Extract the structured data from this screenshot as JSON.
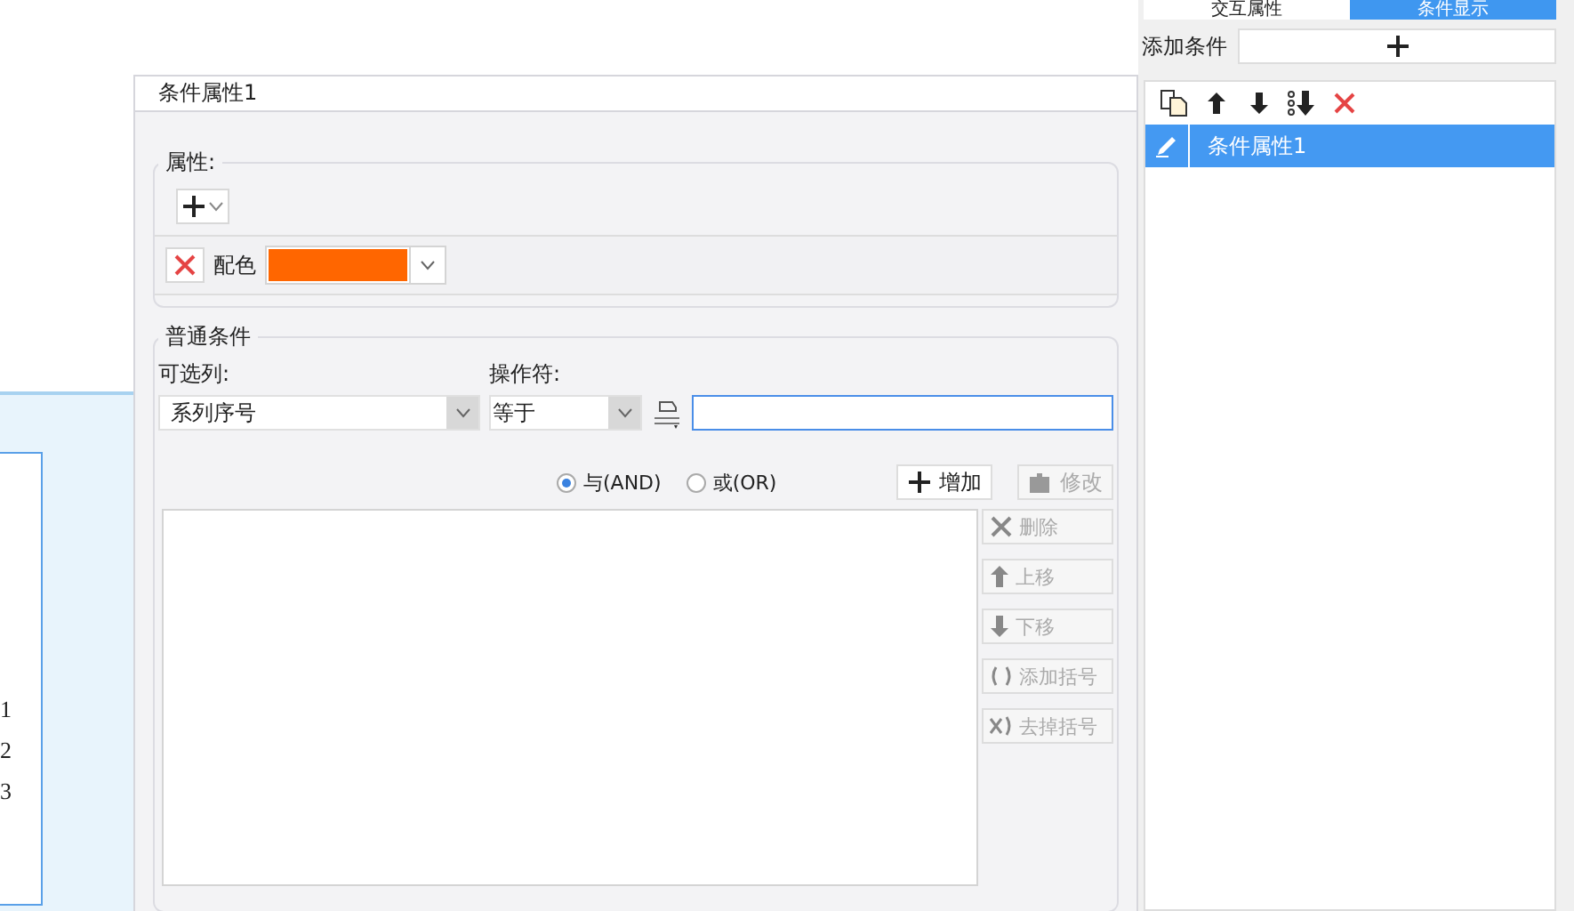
{
  "canvas": {
    "axis_labels": [
      "1",
      "2",
      "3"
    ]
  },
  "dialog": {
    "title": "条件属性1",
    "properties": {
      "legend": "属性:",
      "items": [
        {
          "label": "配色",
          "color": "#ff6600"
        }
      ]
    },
    "conditions": {
      "legend": "普通条件",
      "column_label": "可选列:",
      "column_value": "系列序号",
      "operator_label": "操作符:",
      "operator_value": "等于",
      "logic": [
        {
          "label": "与(AND)",
          "selected": true
        },
        {
          "label": "或(OR)",
          "selected": false
        }
      ],
      "buttons": [
        {
          "kind": "add",
          "label": "增加",
          "disabled": false
        },
        {
          "kind": "edit",
          "label": "修改",
          "disabled": true
        }
      ],
      "side_buttons": [
        {
          "kind": "delete",
          "label": "删除",
          "disabled": true
        },
        {
          "kind": "up",
          "label": "上移",
          "disabled": true
        },
        {
          "kind": "down",
          "label": "下移",
          "disabled": true
        },
        {
          "kind": "add-bracket",
          "label": "添加括号",
          "disabled": true
        },
        {
          "kind": "remove-bracket",
          "label": "去掉括号",
          "disabled": true
        }
      ]
    }
  },
  "side_panel": {
    "tabs": [
      {
        "label": "交互属性",
        "selected": false
      },
      {
        "label": "条件显示",
        "selected": true
      }
    ],
    "add_condition": {
      "label": "添加条件"
    },
    "conditions": [
      {
        "label": "条件属性1",
        "selected": true
      }
    ]
  }
}
